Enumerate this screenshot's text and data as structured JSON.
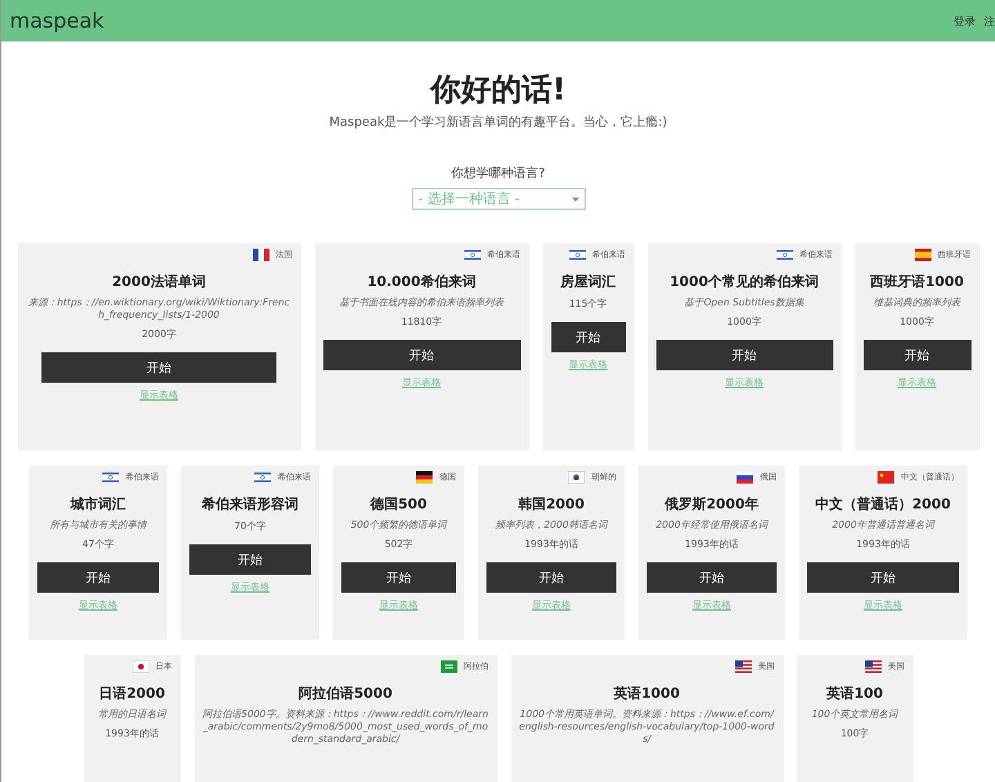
{
  "header": {
    "logo": "maspeak",
    "links": [
      "登录",
      "注"
    ]
  },
  "hero": {
    "title": "你好的话!",
    "subtitle": "Maspeak是一个学习新语言单词的有趣平台。当心，它上瘾:)"
  },
  "language_select": {
    "label": "你想学哪种语言?",
    "placeholder": "- 选择一种语言 -"
  },
  "card_rows": [
    [
      {
        "flag": {
          "kind": "fr"
        },
        "lang": "法国",
        "title": "2000法语单词",
        "description": "来源：https：//en.wiktionary.org/wiki/Wiktionary:French_frequency_lists/1-2000",
        "count": "2000字",
        "button": "开始",
        "link": "显示表格"
      },
      {
        "flag": {
          "kind": "il"
        },
        "lang": "希伯来语",
        "title": "10.000希伯来词",
        "description": "基于书面在线内容的希伯来语频率列表",
        "count": "11810字",
        "button": "开始",
        "link": "显示表格"
      },
      {
        "flag": {
          "kind": "il"
        },
        "lang": "希伯来语",
        "title": "房屋词汇",
        "count": "115个字",
        "button": "开始",
        "link": "显示表格"
      },
      {
        "flag": {
          "kind": "il"
        },
        "lang": "希伯来语",
        "title": "1000个常见的希伯来词",
        "description": "基于Open Subtitles数据集",
        "count": "1000字",
        "button": "开始",
        "link": "显示表格"
      },
      {
        "flag": {
          "kind": "es"
        },
        "lang": "西班牙语",
        "title": "西班牙语1000",
        "description": "维基词典的频率列表",
        "count": "1000字",
        "button": "开始",
        "link": "显示表格"
      }
    ],
    [
      {
        "flag": {
          "kind": "il"
        },
        "lang": "希伯来语",
        "title": "城市词汇",
        "description": "所有与城市有关的事情",
        "count": "47个字",
        "button": "开始",
        "link": "显示表格"
      },
      {
        "flag": {
          "kind": "il"
        },
        "lang": "希伯来语",
        "title": "希伯来语形容词",
        "count": "70个字",
        "button": "开始",
        "link": "显示表格"
      },
      {
        "flag": {
          "kind": "de"
        },
        "lang": "德国",
        "title": "德国500",
        "description": "500个频繁的德语单词",
        "count": "502字",
        "button": "开始",
        "link": "显示表格"
      },
      {
        "flag": {
          "kind": "kr"
        },
        "lang": "朝鲜的",
        "title": "韩国2000",
        "description": "频率列表，2000韩语名词",
        "count": "1993年的话",
        "button": "开始",
        "link": "显示表格"
      },
      {
        "flag": {
          "kind": "ru"
        },
        "lang": "俄国",
        "title": "俄罗斯2000年",
        "description": "2000年经常使用俄语名词",
        "count": "1993年的话",
        "button": "开始",
        "link": "显示表格"
      },
      {
        "flag": {
          "kind": "cn"
        },
        "lang": "中文（普通话）",
        "title": "中文（普通话）2000",
        "description": "2000年普通话普通名词",
        "count": "1993年的话",
        "button": "开始",
        "link": "显示表格"
      }
    ],
    [
      {
        "flag": {
          "kind": "jp"
        },
        "lang": "日本",
        "title": "日语2000",
        "description": "常用的日语名词",
        "count": "1993年的话"
      },
      {
        "flag": {
          "kind": "sa"
        },
        "lang": "阿拉伯",
        "title": "阿拉伯语5000",
        "description": "阿拉伯语5000字。资料来源：https：//www.reddit.com/r/learn_arabic/comments/2y9mo8/5000_most_used_words_of_modern_standard_arabic/"
      },
      {
        "flag": {
          "kind": "us"
        },
        "lang": "美国",
        "title": "英语1000",
        "description": "1000个常用英语单词。资料来源：https：//www.ef.com/english-resources/english-vocabulary/top-1000-words/"
      },
      {
        "flag": {
          "kind": "us"
        },
        "lang": "美国",
        "title": "英语100",
        "description": "100个英文常用名词",
        "count": "100字"
      }
    ]
  ]
}
